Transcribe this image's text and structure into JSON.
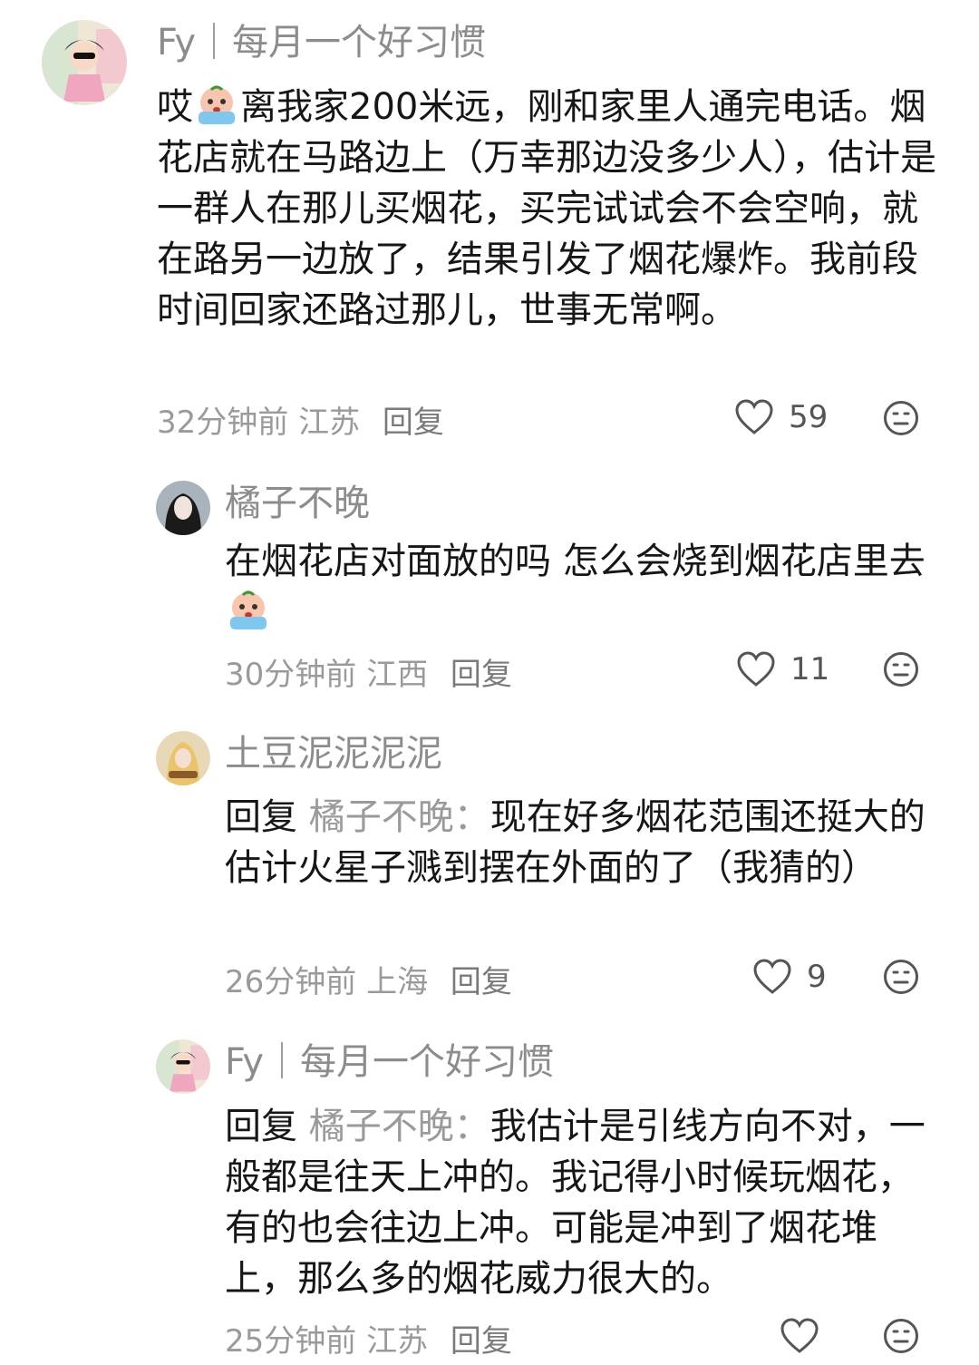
{
  "comments": [
    {
      "username": "Fy｜每月一个好习惯",
      "text_pre": "哎",
      "text_post": "离我家200米远，刚和家里人通完电话。烟花店就在马路边上（万幸那边没多少人），估计是一群人在那儿买烟花，买完试试会不会空响，就在路另一边放了，结果引发了烟花爆炸。我前段时间回家还路过那儿，世事无常啊。",
      "time": "32分钟前",
      "location": "江苏",
      "reply_label": "回复",
      "likes": "59"
    },
    {
      "username": "橘子不晚",
      "text_pre": "在烟花店对面放的吗 怎么会烧到烟花店里去",
      "time": "30分钟前",
      "location": "江西",
      "reply_label": "回复",
      "likes": "11"
    },
    {
      "username": "土豆泥泥泥泥",
      "reply_prefix": "回复",
      "reply_to": "橘子不晚：",
      "text_post": "现在好多烟花范围还挺大的 估计火星子溅到摆在外面的了（我猜的）",
      "time": "26分钟前",
      "location": "上海",
      "reply_label": "回复",
      "likes": "9"
    },
    {
      "username": "Fy｜每月一个好习惯",
      "reply_prefix": "回复",
      "reply_to": "橘子不晚：",
      "text_post": "我估计是引线方向不对，一般都是往天上冲的。我记得小时候玩烟花，有的也会往边上冲。可能是冲到了烟花堆上，那么多的烟花威力很大的。",
      "time": "25分钟前",
      "location": "江苏",
      "reply_label": "回复"
    }
  ],
  "icons": {
    "like": "heart-outline-icon",
    "dislike": "meh-face-icon",
    "emoji": "crying-emoji"
  },
  "colors": {
    "name": "#8c8c8c",
    "meta": "#9a9a9a",
    "text": "#161616"
  }
}
